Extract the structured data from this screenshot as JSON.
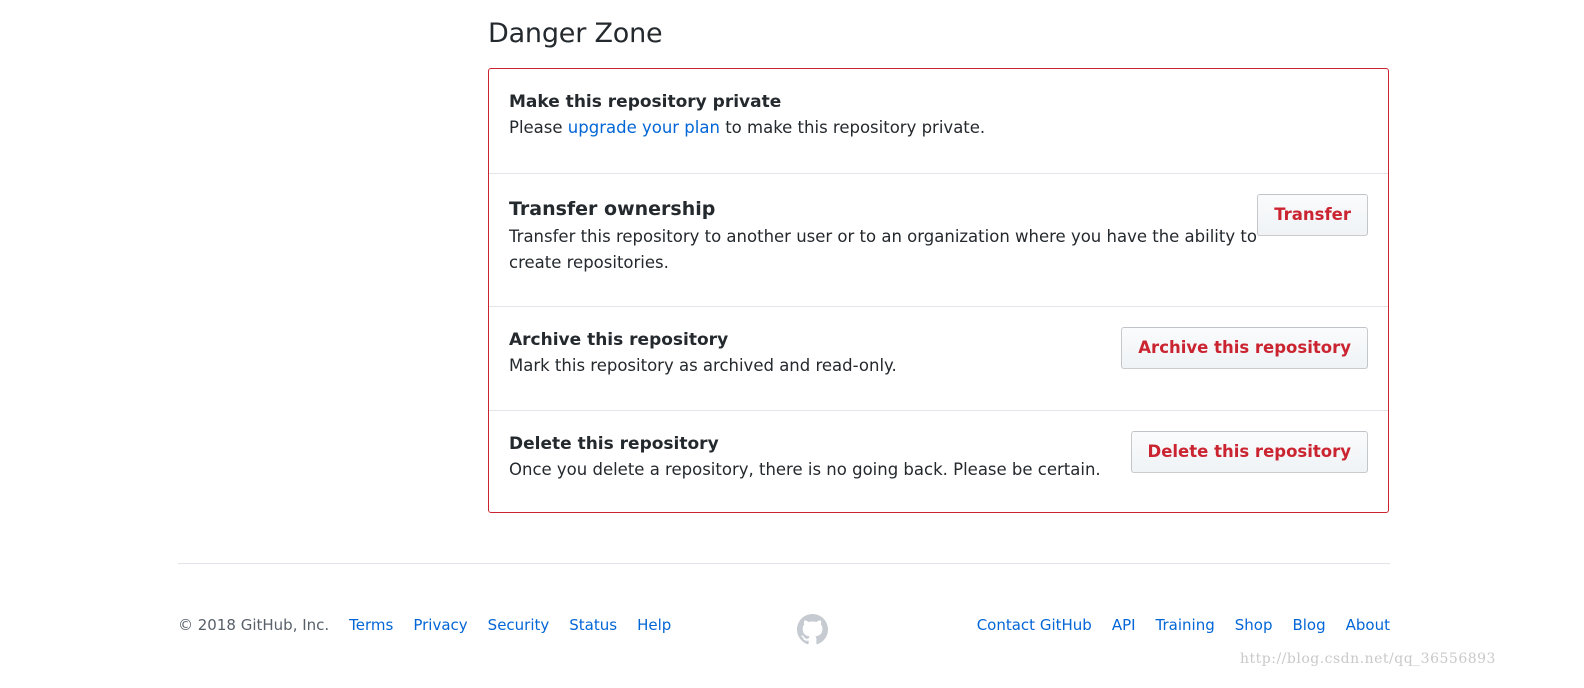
{
  "danger_zone": {
    "title": "Danger Zone",
    "items": [
      {
        "title": "Make this repository private",
        "desc_prefix": "Please ",
        "desc_link": "upgrade your plan",
        "desc_suffix": " to make this repository private."
      },
      {
        "title": "Transfer ownership",
        "desc": "Transfer this repository to another user or to an organization where you have the ability to create repositories.",
        "button": "Transfer"
      },
      {
        "title": "Archive this repository",
        "desc": "Mark this repository as archived and read-only.",
        "button": "Archive this repository"
      },
      {
        "title": "Delete this repository",
        "desc": "Once you delete a repository, there is no going back. Please be certain.",
        "button": "Delete this repository"
      }
    ]
  },
  "footer": {
    "copyright": "© 2018 GitHub, Inc.",
    "left_links": [
      "Terms",
      "Privacy",
      "Security",
      "Status",
      "Help"
    ],
    "right_links": [
      "Contact GitHub",
      "API",
      "Training",
      "Shop",
      "Blog",
      "About"
    ],
    "logo_icon": "github-octocat-icon"
  },
  "watermark": "http://blog.csdn.net/qq_36556893",
  "colors": {
    "danger": "#cb2431",
    "link": "#0366d6",
    "text": "#24292e",
    "muted": "#586069",
    "border": "#e1e4e8"
  }
}
